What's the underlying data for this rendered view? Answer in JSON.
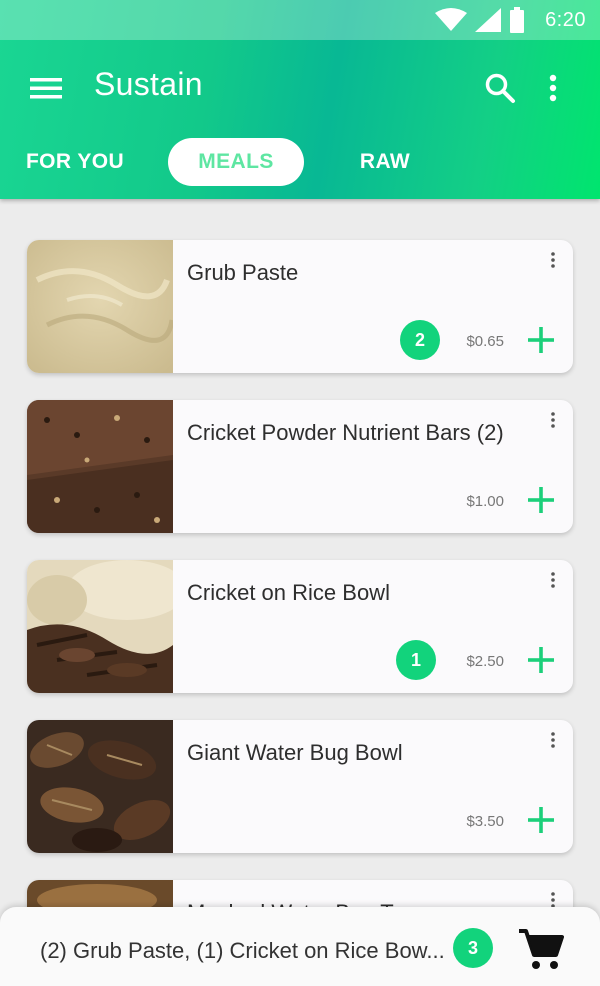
{
  "status_bar": {
    "time": "6:20",
    "icons": [
      "wifi-icon",
      "cell-signal-icon",
      "battery-icon"
    ]
  },
  "app_bar": {
    "title": "Sustain",
    "icons": [
      "menu-icon",
      "search-icon",
      "more-vert-icon"
    ]
  },
  "tabs": [
    {
      "label": "FOR YOU",
      "selected": false
    },
    {
      "label": "MEALS",
      "selected": true
    },
    {
      "label": "RAW",
      "selected": false
    }
  ],
  "meals": [
    {
      "title": "Grub Paste",
      "price": "$0.65",
      "count": "2"
    },
    {
      "title": "Cricket Powder Nutrient Bars (2)",
      "price": "$1.00",
      "count": ""
    },
    {
      "title": "Cricket on Rice Bowl",
      "price": "$2.50",
      "count": "1"
    },
    {
      "title": "Giant Water Bug Bowl",
      "price": "$3.50",
      "count": ""
    },
    {
      "title": "Mashed Water Bug Taco",
      "price": "",
      "count": ""
    }
  ],
  "cart": {
    "summary": "(2) Grub Paste, (1) Cricket on Rice Bow...",
    "count": "3",
    "icon": "cart-icon"
  },
  "colors": {
    "accent": "#12d37c",
    "header_start": "#1ad693",
    "header_end": "#00e56e",
    "tab_selected_text": "#5ee6a2"
  }
}
